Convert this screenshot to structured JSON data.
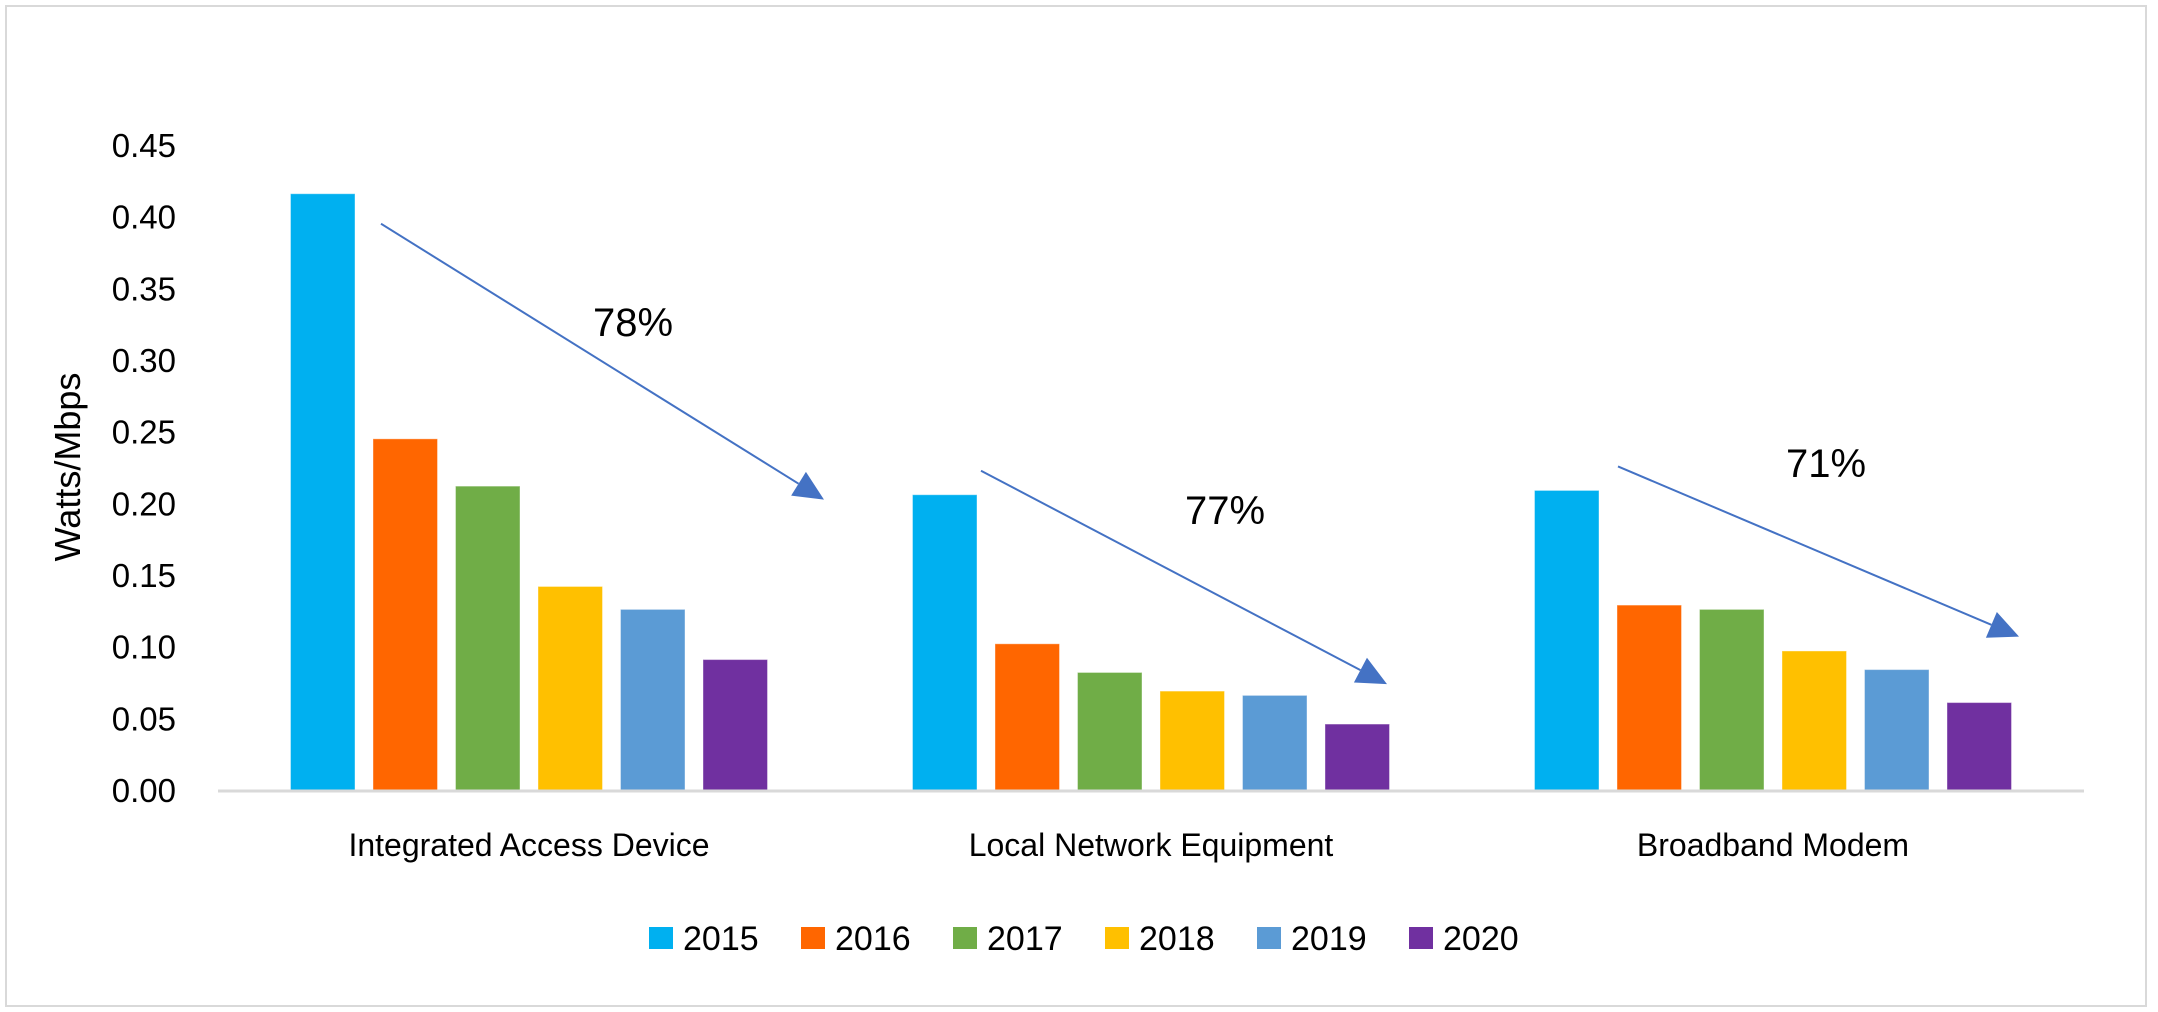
{
  "chart_data": {
    "type": "bar",
    "title": "",
    "xlabel": "",
    "ylabel": "Watts/Mbps",
    "ylim": [
      0,
      0.45
    ],
    "yticks": [
      0.0,
      0.05,
      0.1,
      0.15,
      0.2,
      0.25,
      0.3,
      0.35,
      0.4,
      0.45
    ],
    "ytick_labels": [
      "0.00",
      "0.05",
      "0.10",
      "0.15",
      "0.20",
      "0.25",
      "0.30",
      "0.35",
      "0.40",
      "0.45"
    ],
    "grid": false,
    "legend_position": "bottom",
    "categories": [
      "Integrated Access Device",
      "Local Network Equipment",
      "Broadband Modem"
    ],
    "series": [
      {
        "name": "2015",
        "color": "#00b0f0",
        "values": [
          0.416,
          0.206,
          0.209
        ]
      },
      {
        "name": "2016",
        "color": "#ff6600",
        "values": [
          0.245,
          0.102,
          0.129
        ]
      },
      {
        "name": "2017",
        "color": "#70ad47",
        "values": [
          0.212,
          0.082,
          0.126
        ]
      },
      {
        "name": "2018",
        "color": "#ffc000",
        "values": [
          0.142,
          0.069,
          0.097
        ]
      },
      {
        "name": "2019",
        "color": "#5b9bd5",
        "values": [
          0.126,
          0.066,
          0.084
        ]
      },
      {
        "name": "2020",
        "color": "#7030a0",
        "values": [
          0.091,
          0.046,
          0.061
        ]
      }
    ],
    "annotations": [
      {
        "category": "Integrated Access Device",
        "text": "78%",
        "type": "decline-arrow"
      },
      {
        "category": "Local Network Equipment",
        "text": "77%",
        "type": "decline-arrow"
      },
      {
        "category": "Broadband Modem",
        "text": "71%",
        "type": "decline-arrow"
      }
    ],
    "annotation_color": "#4472c4",
    "axis_color": "#d9d9d9"
  }
}
